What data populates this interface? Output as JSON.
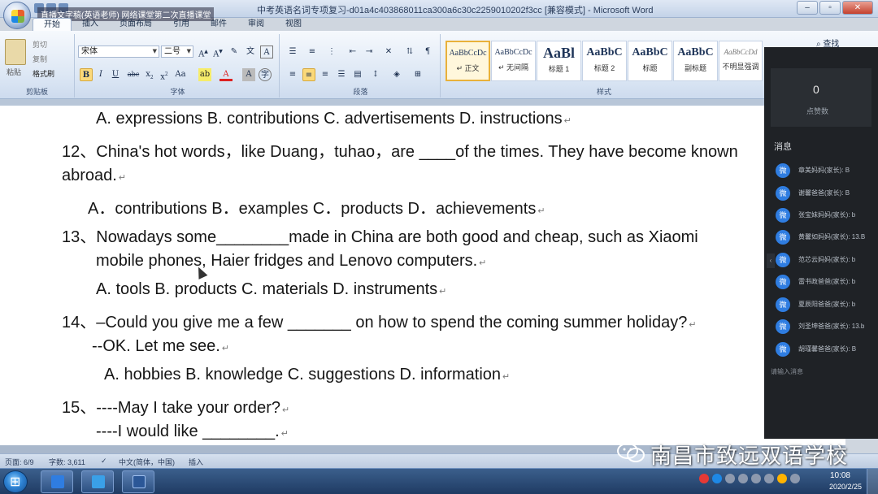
{
  "window": {
    "title": "中考英语名词专项复习-d01a4c403868011ca300a6c30c2259010202f3cc [兼容模式] - Microsoft Word",
    "overlay_text": "直播文字稿(英语老师) 网络课堂第二次直播课堂",
    "buttons": {
      "minimize": "–",
      "maximize": "▫",
      "close": "✕"
    }
  },
  "ribbon": {
    "tabs": [
      "开始",
      "插入",
      "页面布局",
      "引用",
      "邮件",
      "审阅",
      "视图"
    ],
    "active_tab": "开始",
    "clipboard": {
      "paste": "粘贴",
      "cut": "剪切",
      "copy": "复制",
      "format_painter": "格式刷",
      "label": "剪贴板"
    },
    "font": {
      "name": "宋体",
      "size": "二号",
      "label": "字体"
    },
    "paragraph": {
      "label": "段落"
    },
    "styles": {
      "label": "样式",
      "items": [
        {
          "sample": "AaBbCcDc",
          "name": "↵ 正文",
          "selected": true
        },
        {
          "sample": "AaBbCcDc",
          "name": "↵ 无间隔",
          "selected": false
        },
        {
          "sample": "AaBl",
          "name": "标题 1",
          "selected": false
        },
        {
          "sample": "AaBbC",
          "name": "标题 2",
          "selected": false
        },
        {
          "sample": "AaBbC",
          "name": "标题",
          "selected": false
        },
        {
          "sample": "AaBbC",
          "name": "副标题",
          "selected": false
        },
        {
          "sample": "AaBbCcDd",
          "name": "不明显强调",
          "selected": false
        }
      ]
    },
    "find": "查找"
  },
  "document": {
    "lines": [
      {
        "text": "A. expressions    B. contributions   C. advertisements    D. instructions",
        "mark": "↵"
      },
      {
        "text": "12、China's hot words，like Duang，tuhao，are  ____of the times. They have become known",
        "mark": ""
      },
      {
        "text": "abroad.",
        "mark": "↵"
      },
      {
        "text": "A．contributions    B．examples      C．products        D．achievements",
        "mark": "↵"
      },
      {
        "text": "13、Nowadays some________made  in  China  are  both  good  and  cheap,  such  as  Xiaomi",
        "mark": ""
      },
      {
        "text": "mobile phones, Haier fridges and Lenovo computers.",
        "mark": "↵"
      },
      {
        "text": "A. tools          B. products      C. materials       D. instruments",
        "mark": "↵"
      },
      {
        "text": "14、–Could you give me a few _______ on how to spend the coming summer holiday?",
        "mark": "↵"
      },
      {
        "text": "--OK. Let me see.",
        "mark": "↵"
      },
      {
        "text": "A. hobbies           B. knowledge   C. suggestions    D. information",
        "mark": "↵"
      },
      {
        "text": "15、----May I take your order?",
        "mark": "↵"
      },
      {
        "text": "----I would like ________.",
        "mark": "↵"
      }
    ]
  },
  "panel": {
    "likes_count": "0",
    "likes_label": "点赞数",
    "messages_title": "消息",
    "messages": [
      {
        "text": "章美妈妈(家长): B"
      },
      {
        "text": "谢馨爸爸(家长): B"
      },
      {
        "text": "张宝妹妈妈(家长): b"
      },
      {
        "text": "黄馨如妈妈(家长): 13.B"
      },
      {
        "text": "范芯云妈妈(家长): b"
      },
      {
        "text": "雷书政爸爸(家长): b"
      },
      {
        "text": "夏辰阳爸爸(家长): b"
      },
      {
        "text": "刘圣坤爸爸(家长): 13.b"
      },
      {
        "text": "胡瑾馨爸爸(家长): B"
      }
    ],
    "input_placeholder": "请输入消息"
  },
  "statusbar": {
    "page": "页面: 6/9",
    "words": "字数: 3,611",
    "language": "中文(简体，中国)",
    "mode": "插入"
  },
  "taskbar": {
    "time": "10:08",
    "date": "2020/2/25"
  },
  "watermark": {
    "text": "南昌市致远双语学校"
  },
  "colors": {
    "panel_bg": "#1f2226",
    "accent": "#2f7de1",
    "ribbon": "#dbe6f4"
  }
}
